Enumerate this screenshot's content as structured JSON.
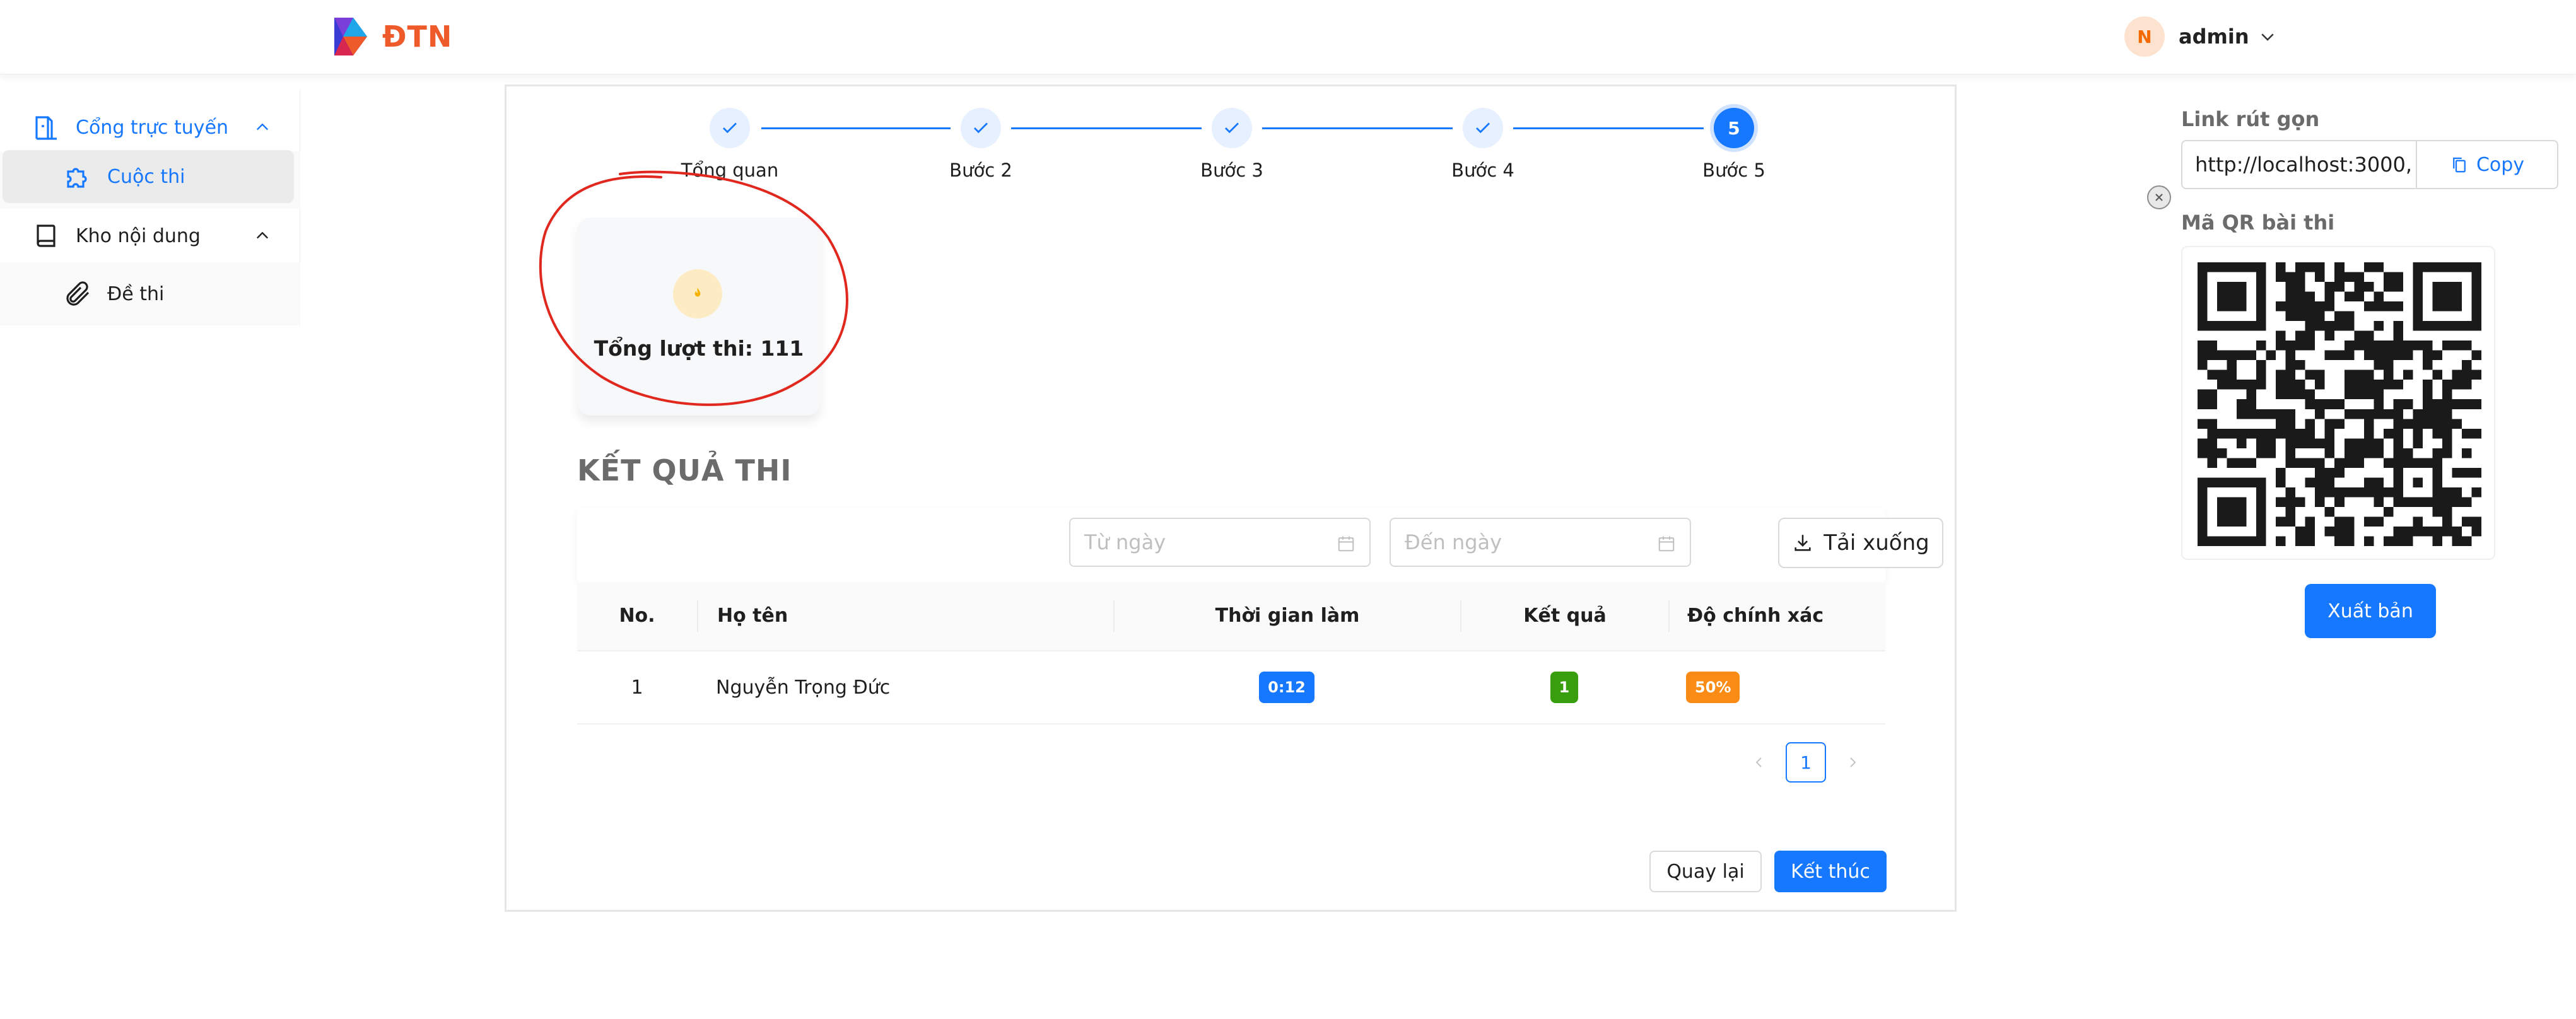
{
  "brand": {
    "name": "ĐTN"
  },
  "user": {
    "initial": "N",
    "name": "admin"
  },
  "sidebar": {
    "items": [
      {
        "label": "Cổng trực tuyến",
        "icon": "portal-icon"
      },
      {
        "label": "Cuộc thi",
        "icon": "puzzle-icon"
      },
      {
        "label": "Kho nội dung",
        "icon": "book-icon"
      },
      {
        "label": "Đề thi",
        "icon": "paperclip-icon"
      }
    ]
  },
  "steps": [
    {
      "label": "Tổng quan",
      "state": "done"
    },
    {
      "label": "Bước 2",
      "state": "done"
    },
    {
      "label": "Bước 3",
      "state": "done"
    },
    {
      "label": "Bước 4",
      "state": "done"
    },
    {
      "label": "Bước 5",
      "state": "active",
      "number": "5"
    }
  ],
  "stat": {
    "label": "Tổng lượt thi: 111",
    "icon": "fire-icon"
  },
  "results": {
    "title": "KẾT QUẢ THI",
    "from_placeholder": "Từ ngày",
    "to_placeholder": "Đến ngày",
    "download_label": "Tải xuống",
    "columns": [
      "No.",
      "Họ tên",
      "Thời gian làm",
      "Kết quả",
      "Độ chính xác"
    ],
    "rows": [
      {
        "no": "1",
        "name": "Nguyễn Trọng Đức",
        "time": "0:12",
        "result": "1",
        "accuracy": "50%"
      }
    ],
    "page": "1"
  },
  "actions": {
    "back_label": "Quay lại",
    "finish_label": "Kết thúc"
  },
  "share": {
    "link_label": "Link rút gọn",
    "link_value": "http://localhost:3000,",
    "copy_label": "Copy",
    "qr_label": "Mã QR bài thi",
    "publish_label": "Xuất bản"
  },
  "colors": {
    "primary": "#1677ff",
    "success": "#389e0d",
    "warning": "#fa8c16",
    "annotation": "#e0281e"
  }
}
